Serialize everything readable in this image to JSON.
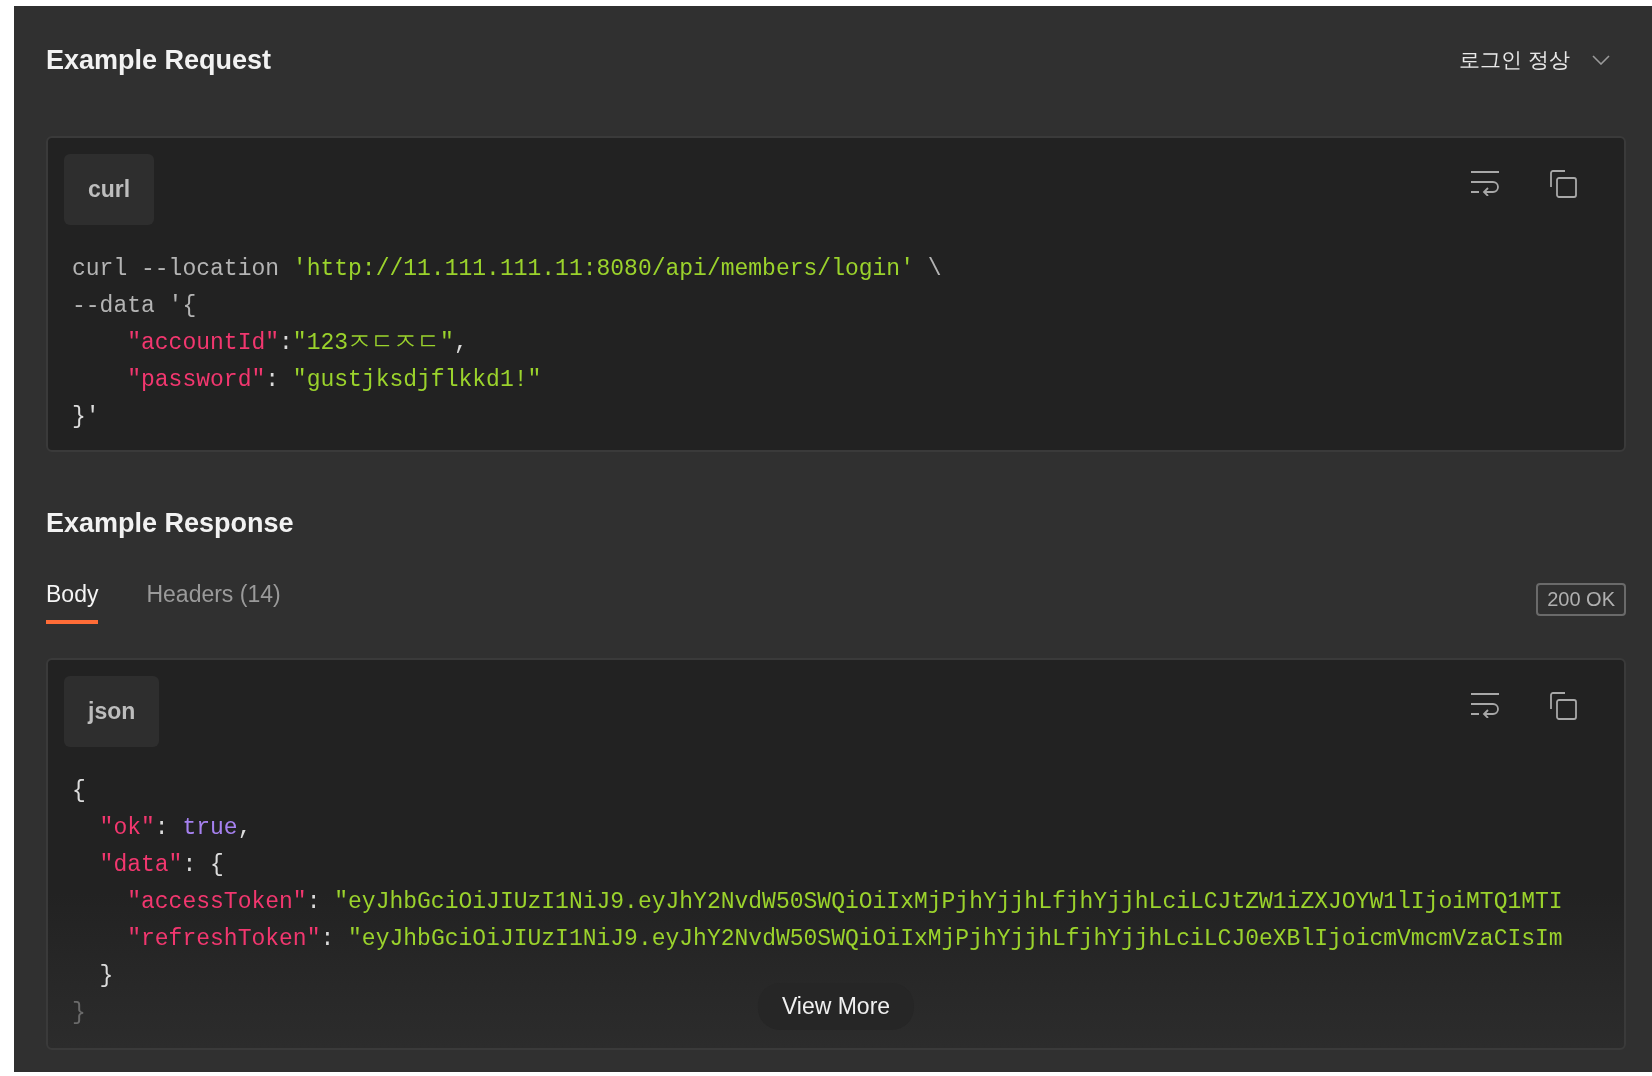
{
  "request": {
    "title": "Example Request",
    "example_select": {
      "label": "로그인 정상"
    },
    "code": {
      "language": "curl",
      "lines": [
        [
          {
            "text": "curl --location ",
            "kind": "plain"
          },
          {
            "text": "'http://11.111.111.11:8080/api/members/login'",
            "kind": "string"
          },
          {
            "text": " \\",
            "kind": "plain"
          }
        ],
        [
          {
            "text": "--data '{",
            "kind": "plain"
          }
        ],
        [
          {
            "text": "    \"accountId\"",
            "kind": "key"
          },
          {
            "text": ":",
            "kind": "punct"
          },
          {
            "text": "\"123ㅈㄷㅈㄷ\"",
            "kind": "string"
          },
          {
            "text": ",",
            "kind": "punct"
          }
        ],
        [
          {
            "text": "    \"password\"",
            "kind": "key"
          },
          {
            "text": ": ",
            "kind": "punct"
          },
          {
            "text": "\"gustjksdjflkkd1!\"",
            "kind": "string"
          }
        ],
        [
          {
            "text": "}'",
            "kind": "punct"
          }
        ]
      ]
    }
  },
  "response": {
    "title": "Example Response",
    "tabs": [
      {
        "label": "Body",
        "selected": true
      },
      {
        "label": "Headers (14)",
        "selected": false
      }
    ],
    "status": "200 OK",
    "code": {
      "language": "json",
      "lines": [
        [
          {
            "text": "{",
            "kind": "punct"
          }
        ],
        [
          {
            "text": "  \"ok\"",
            "kind": "key"
          },
          {
            "text": ": ",
            "kind": "punct"
          },
          {
            "text": "true",
            "kind": "keyword"
          },
          {
            "text": ",",
            "kind": "punct"
          }
        ],
        [
          {
            "text": "  \"data\"",
            "kind": "key"
          },
          {
            "text": ": {",
            "kind": "punct"
          }
        ],
        [
          {
            "text": "    \"accessToken\"",
            "kind": "key"
          },
          {
            "text": ": ",
            "kind": "punct"
          },
          {
            "text": "\"eyJhbGciOiJIUzI1NiJ9.eyJhY2NvdW50SWQiOiIxMjPjhYjjhLfjhYjjhLciLCJtZW1iZXJOYW1lIjoiMTQ1MTI",
            "kind": "string"
          }
        ],
        [
          {
            "text": "    \"refreshToken\"",
            "kind": "key"
          },
          {
            "text": ": ",
            "kind": "punct"
          },
          {
            "text": "\"eyJhbGciOiJIUzI1NiJ9.eyJhY2NvdW50SWQiOiIxMjPjhYjjhLfjhYjjhLciLCJ0eXBlIjoicmVmcmVzaCIsIm",
            "kind": "string"
          }
        ],
        [
          {
            "text": "  }",
            "kind": "punct"
          }
        ],
        [
          {
            "text": "}",
            "kind": "dim"
          }
        ]
      ]
    },
    "view_more": "View More"
  }
}
